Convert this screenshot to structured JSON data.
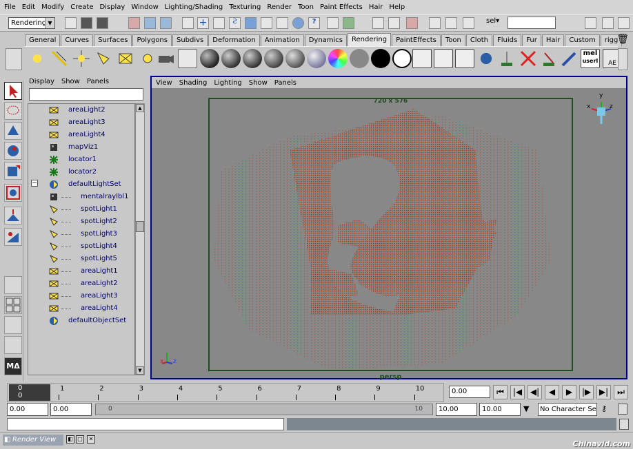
{
  "menu": [
    "File",
    "Edit",
    "Modify",
    "Create",
    "Display",
    "Window",
    "Lighting/Shading",
    "Texturing",
    "Render",
    "Toon",
    "Paint Effects",
    "Hair",
    "Help"
  ],
  "status": {
    "mode": "Rendering",
    "sel_label": "sel▾"
  },
  "shelf_tabs": [
    "General",
    "Curves",
    "Surfaces",
    "Polygons",
    "Subdivs",
    "Deformation",
    "Animation",
    "Dynamics",
    "Rendering",
    "PaintEffects",
    "Toon",
    "Cloth",
    "Fluids",
    "Fur",
    "Hair",
    "Custom",
    "rigg"
  ],
  "shelf_active_tab": "Rendering",
  "shelf_labels": {
    "mel": "mel",
    "user": "userI",
    "ae": "AE"
  },
  "outliner": {
    "menu": [
      "Display",
      "Show",
      "Panels"
    ],
    "items": [
      {
        "label": "areaLight2",
        "icon": "area-light-icon",
        "indent": 0
      },
      {
        "label": "areaLight3",
        "icon": "area-light-icon",
        "indent": 0
      },
      {
        "label": "areaLight4",
        "icon": "area-light-icon",
        "indent": 0
      },
      {
        "label": "mapViz1",
        "icon": "map-viz-icon",
        "indent": 0
      },
      {
        "label": "locator1",
        "icon": "locator-icon",
        "indent": 0
      },
      {
        "label": "locator2",
        "icon": "locator-icon",
        "indent": 0
      },
      {
        "label": "defaultLightSet",
        "icon": "set-icon",
        "indent": 0,
        "expand": "−"
      },
      {
        "label": "mentalraylbl1",
        "icon": "map-viz-icon",
        "indent": 1
      },
      {
        "label": "spotLight1",
        "icon": "spot-light-icon",
        "indent": 1
      },
      {
        "label": "spotLight2",
        "icon": "spot-light-icon",
        "indent": 1
      },
      {
        "label": "spotLight3",
        "icon": "spot-light-icon",
        "indent": 1
      },
      {
        "label": "spotLight4",
        "icon": "spot-light-icon",
        "indent": 1
      },
      {
        "label": "spotLight5",
        "icon": "spot-light-icon",
        "indent": 1
      },
      {
        "label": "areaLight1",
        "icon": "area-light-icon",
        "indent": 1
      },
      {
        "label": "areaLight2",
        "icon": "area-light-icon",
        "indent": 1
      },
      {
        "label": "areaLight3",
        "icon": "area-light-icon",
        "indent": 1
      },
      {
        "label": "areaLight4",
        "icon": "area-light-icon",
        "indent": 1
      },
      {
        "label": "defaultObjectSet",
        "icon": "set-icon",
        "indent": 0
      }
    ]
  },
  "viewport": {
    "menu": [
      "View",
      "Shading",
      "Lighting",
      "Show",
      "Panels"
    ],
    "resolution": "720 x 576",
    "camera": "persp",
    "axis": {
      "y": "y",
      "x": "x",
      "z": "z"
    }
  },
  "timeline": {
    "current_frame_display": [
      "0",
      "0"
    ],
    "ticks": [
      "1",
      "2",
      "3",
      "4",
      "5",
      "6",
      "7",
      "8",
      "9",
      "10"
    ],
    "current_frame": "0.00"
  },
  "range": {
    "start": "0.00",
    "playback_start": "0.00",
    "slider_start": "0",
    "slider_end": "10",
    "playback_end": "10.00",
    "end": "10.00",
    "character_set": "No Character Set"
  },
  "taskbar": {
    "window_title": "Render View"
  },
  "watermark": "Chinavid.com"
}
